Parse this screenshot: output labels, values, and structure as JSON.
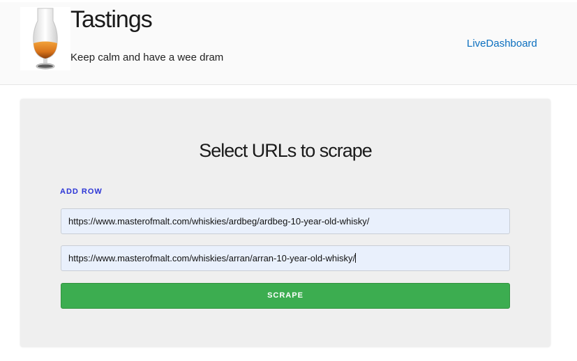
{
  "header": {
    "title": "Tastings",
    "tagline": "Keep calm and have a wee dram",
    "nav_link": "LiveDashboard",
    "logo_icon": "whisky-glass-icon"
  },
  "main": {
    "heading": "Select URLs to scrape",
    "add_row_label": "ADD ROW",
    "urls": [
      "https://www.masterofmalt.com/whiskies/ardbeg/ardbeg-10-year-old-whisky/",
      "https://www.masterofmalt.com/whiskies/arran/arran-10-year-old-whisky/"
    ],
    "scrape_label": "SCRAPE"
  },
  "colors": {
    "accent_link": "#0b6fbf",
    "add_row": "#2b34d6",
    "scrape_button": "#3cad50",
    "input_bg": "#e9f0fc"
  }
}
